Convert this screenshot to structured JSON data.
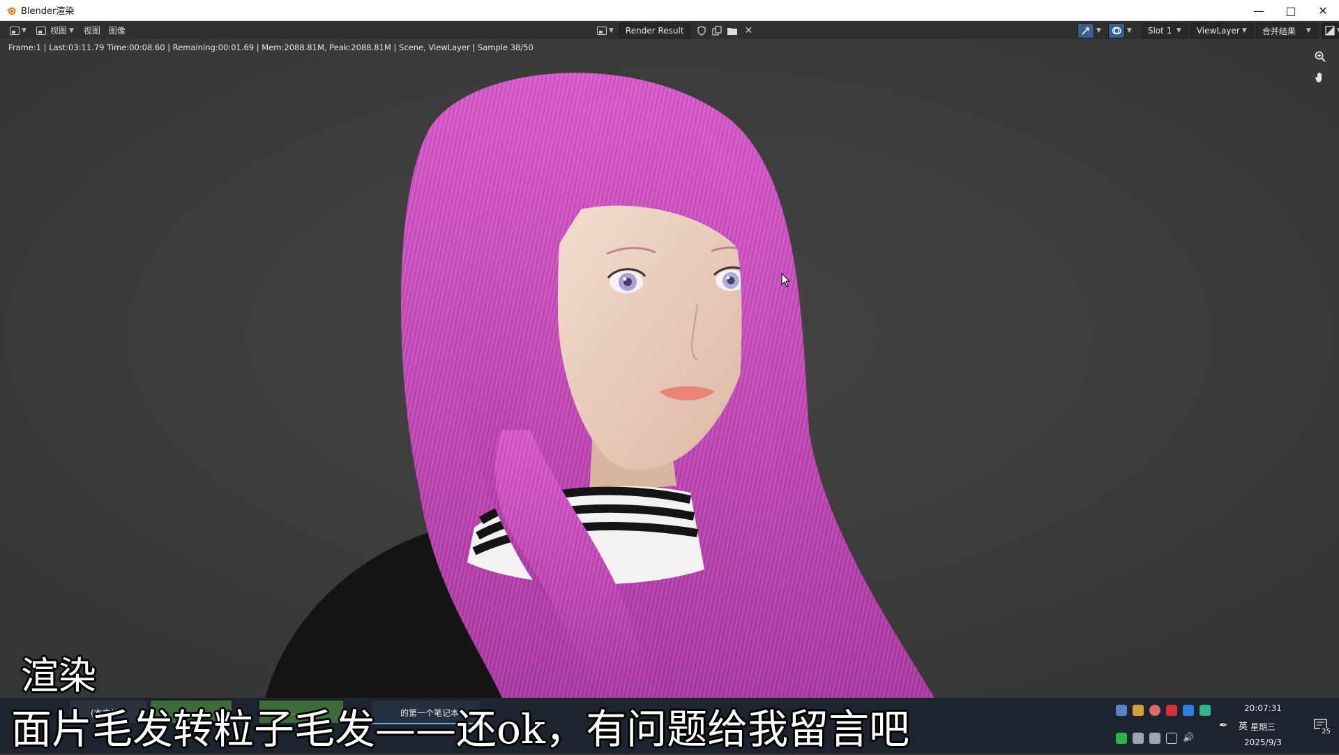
{
  "window": {
    "title": "Blender渲染",
    "minimize_icon": "minimize-icon",
    "maximize_icon": "maximize-icon",
    "close_icon": "close-icon"
  },
  "header": {
    "editor_type_icon": "image-editor-icon",
    "view_menu_primary": "视图",
    "view_menu": "视图",
    "image_menu": "图像",
    "render_result_label": "Render Result",
    "slot_label": "Slot 1",
    "viewlayer_label": "ViewLayer",
    "pass_label": "合并结果"
  },
  "status": {
    "text": "Frame:1 | Last:03:11.79 Time:00:08.60 | Remaining:00:01.69 | Mem:2088.81M, Peak:2088.81M | Scene, ViewLayer | Sample 38/50"
  },
  "viewport": {
    "zoom_icon": "zoom-icon",
    "pan_icon": "hand-pan-icon",
    "colors": {
      "background": "#3c3c3c",
      "hair": "#c84fbe",
      "hair_dark": "#8e2f8c",
      "sweater": "#141414"
    }
  },
  "taskbar": {
    "items": [
      {
        "label": "(本文档"
      },
      {
        "label": "..."
      },
      {
        "label": "..."
      },
      {
        "label": "的第一个笔记本 ..."
      }
    ],
    "tray": {
      "ime_label": "英",
      "time": "20:07:31",
      "weekday": "星期三",
      "date": "2025/9/3",
      "notification_count": "25"
    }
  },
  "subtitles": {
    "line1": "渲染",
    "line2": "面片毛发转粒子毛发——还ok，有问题给我留言吧"
  }
}
